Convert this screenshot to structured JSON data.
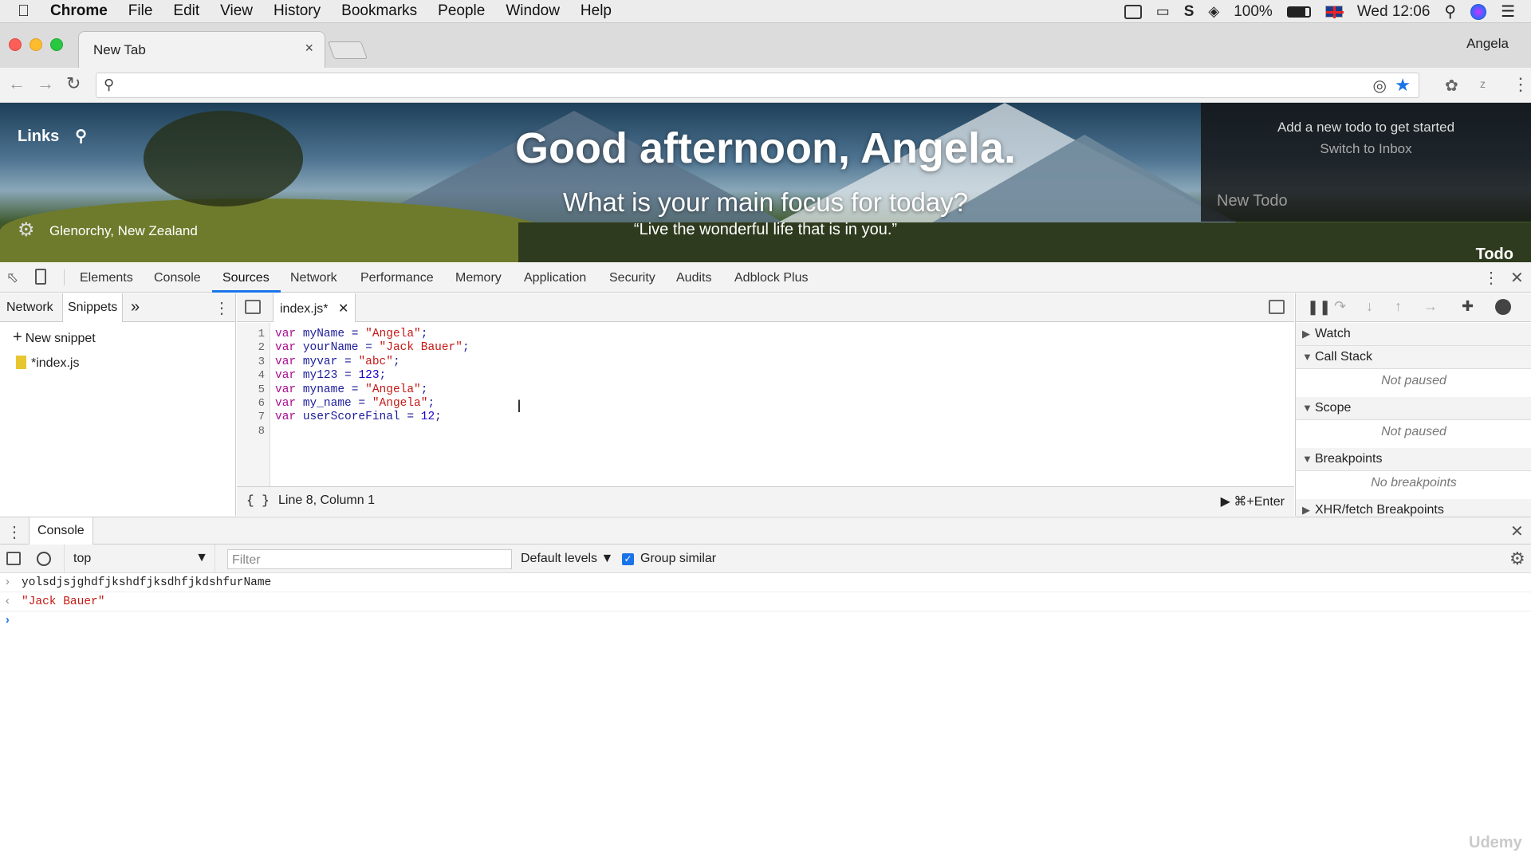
{
  "menubar": {
    "app": "Chrome",
    "items": [
      "File",
      "Edit",
      "View",
      "History",
      "Bookmarks",
      "People",
      "Window",
      "Help"
    ],
    "battery": "100%",
    "clock": "Wed 12:06"
  },
  "browser": {
    "tab_title": "New Tab",
    "tab_close": "×",
    "profile": "Angela",
    "omnibox_value": ""
  },
  "newtab": {
    "links_label": "Links",
    "greeting": "Good afternoon, Angela.",
    "focus_question": "What is your main focus for today?",
    "quote": "“Live the wonderful life that is in you.”",
    "location": "Glenorchy, New Zealand",
    "todo": {
      "empty_title": "Add a new todo to get started",
      "switch_link": "Switch to Inbox",
      "input_placeholder": "New Todo",
      "label": "Todo"
    }
  },
  "devtools": {
    "tabs": [
      "Elements",
      "Console",
      "Sources",
      "Network",
      "Performance",
      "Memory",
      "Application",
      "Security",
      "Audits",
      "Adblock Plus"
    ],
    "active_tab": "Sources",
    "navigator": {
      "tabs": [
        "Network",
        "Snippets"
      ],
      "more": "»",
      "new_snippet": "New snippet",
      "files": [
        "*index.js"
      ]
    },
    "editor": {
      "file_tab": "index.js*",
      "lines": [
        {
          "n": "1",
          "kw": "var",
          "id": "myName",
          "op": " = ",
          "val": "\"Angela\"",
          "end": ";",
          "type": "str"
        },
        {
          "n": "2",
          "kw": "var",
          "id": "yourName",
          "op": " = ",
          "val": "\"Jack Bauer\"",
          "end": ";",
          "type": "str"
        },
        {
          "n": "3",
          "kw": "var",
          "id": "myvar",
          "op": " = ",
          "val": "\"abc\"",
          "end": ";",
          "type": "str"
        },
        {
          "n": "4",
          "kw": "var",
          "id": "my123",
          "op": " = ",
          "val": "123",
          "end": ";",
          "type": "num"
        },
        {
          "n": "5",
          "kw": "var",
          "id": "myname",
          "op": " = ",
          "val": "\"Angela\"",
          "end": ";",
          "type": "str"
        },
        {
          "n": "6",
          "kw": "var",
          "id": "my_name",
          "op": " = ",
          "val": "\"Angela\"",
          "end": ";",
          "type": "str"
        },
        {
          "n": "7",
          "kw": "var",
          "id": "userScoreFinal",
          "op": " = ",
          "val": "12",
          "end": ";",
          "type": "num"
        },
        {
          "n": "8",
          "kw": "",
          "id": "",
          "op": "",
          "val": "",
          "end": "",
          "type": "empty"
        }
      ],
      "status": "Line 8, Column 1",
      "run_hint": "⌘+Enter",
      "format_btn": "{ }"
    },
    "debugger": {
      "sections": [
        {
          "label": "Watch",
          "expanded": false,
          "note": ""
        },
        {
          "label": "Call Stack",
          "expanded": true,
          "note": "Not paused"
        },
        {
          "label": "Scope",
          "expanded": true,
          "note": "Not paused"
        },
        {
          "label": "Breakpoints",
          "expanded": true,
          "note": "No breakpoints"
        },
        {
          "label": "XHR/fetch Breakpoints",
          "expanded": false,
          "note": ""
        }
      ]
    },
    "console": {
      "drawer_tab": "Console",
      "context": "top",
      "filter_placeholder": "Filter",
      "levels": "Default levels",
      "group_similar": "Group similar",
      "group_similar_checked": true,
      "entries": [
        {
          "kind": "input",
          "text": "yolsdjsjghdfjkshdfjksdhfjkdshfurName"
        },
        {
          "kind": "result",
          "text": "\"Jack Bauer\""
        }
      ]
    }
  },
  "watermark": "Udemy",
  "colors": {
    "accent": "#1a73e8",
    "string": "#c41a16",
    "keyword": "#aa0d91",
    "number": "#1c00cf"
  }
}
